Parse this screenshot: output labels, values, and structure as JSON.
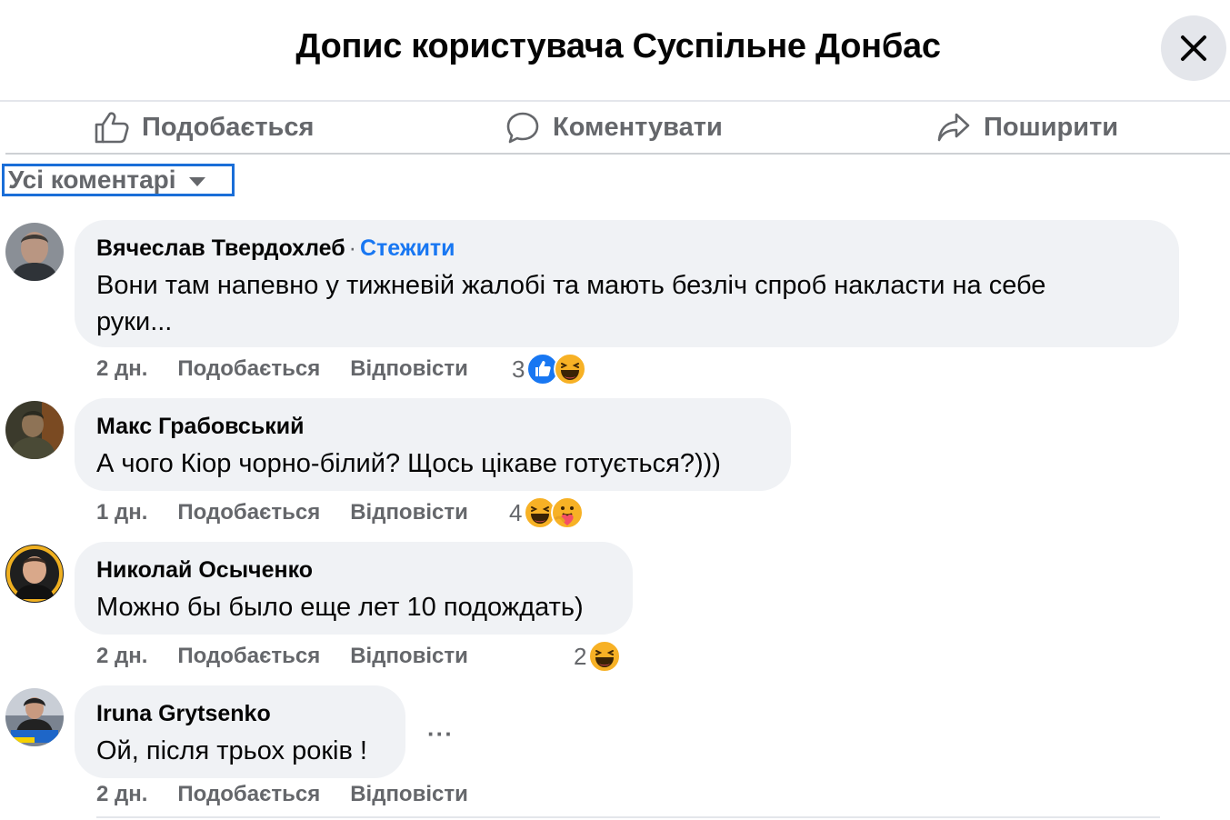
{
  "header": {
    "title": "Допис користувача Суспільне Донбас"
  },
  "actions": {
    "like": "Подобається",
    "comment": "Коментувати",
    "share": "Поширити"
  },
  "filter": {
    "label": "Усі коментарі"
  },
  "comments": [
    {
      "author": "Вячеслав Твердохлеб",
      "dot": "·",
      "follow": "Стежити",
      "line1": "Вони там напевно у тижневій жалобі та мають безліч спроб накласти на себе",
      "line2": "руки...",
      "time": "2 дн.",
      "like": "Подобається",
      "reply": "Відповісти",
      "reaction_count": "3",
      "reactions": [
        "like-icon",
        "haha-icon"
      ]
    },
    {
      "author": "Макс Грабовський",
      "line1": "А чого Кіор чорно-білий? Щось цікаве готується?)))",
      "time": "1 дн.",
      "like": "Подобається",
      "reply": "Відповісти",
      "reaction_count": "4",
      "reactions": [
        "haha-icon",
        "care-icon"
      ]
    },
    {
      "author": "Николай Осыченко",
      "line1": "Можно бы было еще лет 10 подождать)",
      "time": "2 дн.",
      "like": "Подобається",
      "reply": "Відповісти",
      "reaction_count": "2",
      "reactions": [
        "haha-icon"
      ]
    },
    {
      "author": "Iruna Grytsenko",
      "line1": "Ой, після трьох років !",
      "time": "2 дн.",
      "like": "Подобається",
      "reply": "Відповісти",
      "more": "···"
    }
  ],
  "colors": {
    "accent": "#1877f2",
    "bubble": "#f0f2f5",
    "muted": "#65676b",
    "focus": "#1a6ed8"
  }
}
